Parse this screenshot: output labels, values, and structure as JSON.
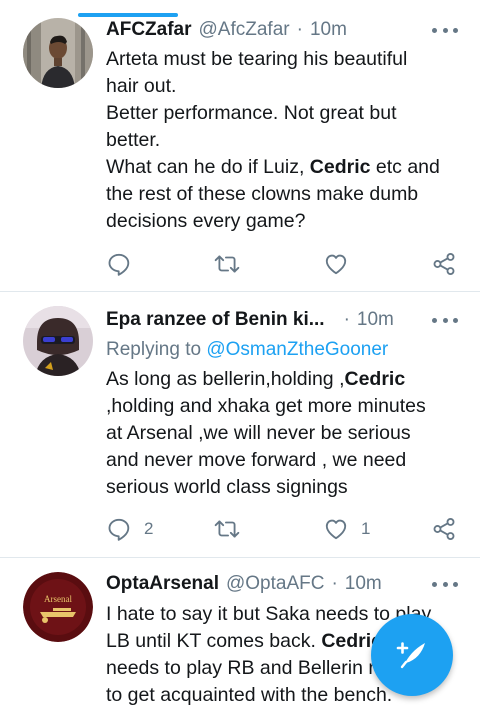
{
  "colors": {
    "accent": "#1da1f2",
    "text": "#14171a",
    "secondary": "#657786",
    "divider": "#e1e8ed"
  },
  "tweets": [
    {
      "name": "AFCZafar",
      "handle": "@AfcZafar",
      "separator": "·",
      "time": "10m",
      "reply_prefix": "",
      "reply_mention": "",
      "lines": [
        [
          "Arteta must be tearing his beautiful"
        ],
        [
          "hair out."
        ],
        [
          "Better performance. Not great but"
        ],
        [
          "better."
        ],
        [
          "What can he do if Luiz, ",
          "Cedric",
          " etc and"
        ],
        [
          "the rest of these clowns make dumb"
        ],
        [
          "decisions every game?"
        ]
      ],
      "reply_count": "",
      "retweet_count": "",
      "like_count": "",
      "icons": [
        "reply-icon",
        "retweet-icon",
        "like-icon",
        "share-icon"
      ]
    },
    {
      "name": "Epa ranzee of Benin ki...",
      "handle": "",
      "separator": "·",
      "time": "10m",
      "reply_prefix": "Replying to ",
      "reply_mention": "@OsmanZtheGooner",
      "lines": [
        [
          "As long as bellerin,holding ,",
          "Cedric",
          ""
        ],
        [
          ",holding and xhaka get more minutes"
        ],
        [
          "at Arsenal ,we will never be serious"
        ],
        [
          "and never move forward , we need"
        ],
        [
          "serious world class signings"
        ]
      ],
      "reply_count": "2",
      "retweet_count": "",
      "like_count": "1",
      "icons": [
        "reply-icon",
        "retweet-icon",
        "like-icon",
        "share-icon"
      ]
    },
    {
      "name": "OptaArsenal",
      "handle": "@OptaAFC",
      "separator": "·",
      "time": "10m",
      "reply_prefix": "",
      "reply_mention": "",
      "lines": [
        [
          "I hate to say it but Saka needs to play"
        ],
        [
          "LB until KT comes back. ",
          "Cedric",
          ""
        ],
        [
          "needs to play RB and Bellerin needs"
        ],
        [
          "to get acquainted with the bench."
        ]
      ],
      "reply_count": "",
      "retweet_count": "",
      "like_count": "",
      "avatar_text": "Arsenal"
    }
  ],
  "fab": {
    "icon": "compose-tweet-icon"
  }
}
